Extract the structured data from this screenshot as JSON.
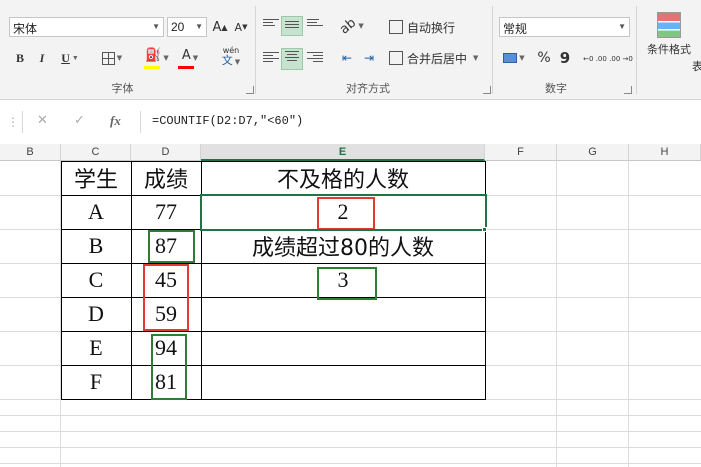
{
  "ribbon": {
    "font": {
      "name": "宋体",
      "size": "20",
      "grow": "A",
      "shrink": "A",
      "bold": "B",
      "italic": "I",
      "underline": "U",
      "font_color": "A",
      "phonetic_top": "wén",
      "phonetic_bottom": "文",
      "label": "字体"
    },
    "alignment": {
      "wrap_text": "自动换行",
      "merge_center": "合并后居中",
      "label": "对齐方式"
    },
    "number": {
      "format": "常规",
      "percent": "%",
      "comma": "9",
      "increase_decimal": "←0 .00",
      "decrease_decimal": ".00 →0",
      "label": "数字"
    },
    "styles": {
      "conditional_format": "条件格式",
      "cut_off": "表"
    },
    "colors": {
      "fill_bar": "#ffff00",
      "font_bar": "#ff0000",
      "accent": "#217346"
    }
  },
  "formula_bar": {
    "cancel": "✕",
    "enter": "✓",
    "fx": "fx",
    "formula": "=COUNTIF(D2:D7,\"<60\")"
  },
  "columns": [
    "B",
    "C",
    "D",
    "E",
    "F",
    "G",
    "H"
  ],
  "selected_column": "E",
  "table": {
    "header_student": "学生",
    "header_score": "成绩",
    "rows": [
      {
        "student": "A",
        "score": "77"
      },
      {
        "student": "B",
        "score": "87"
      },
      {
        "student": "C",
        "score": "45"
      },
      {
        "student": "D",
        "score": "59"
      },
      {
        "student": "E",
        "score": "94"
      },
      {
        "student": "F",
        "score": "81"
      }
    ],
    "fail_label": "不及格的人数",
    "fail_count": "2",
    "over80_label": "成绩超过80的人数",
    "over80_count": "3"
  },
  "highlight_colors": {
    "red": "#e53935",
    "green": "#2e7d32"
  }
}
